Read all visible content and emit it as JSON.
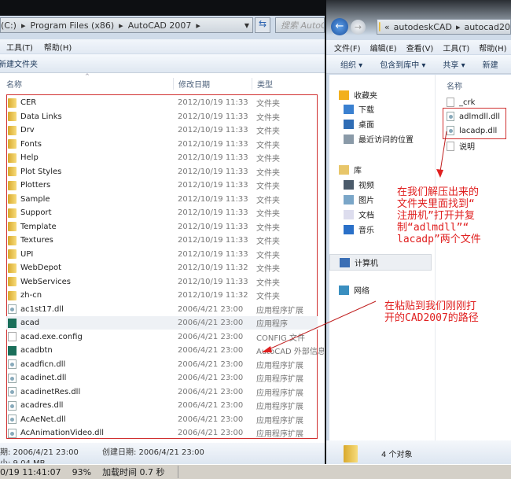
{
  "left": {
    "address": [
      "(C:)",
      "Program Files (x86)",
      "AutoCAD 2007"
    ],
    "search_placeholder": "搜索 AutoC",
    "menu": [
      "工具(T)",
      "帮助(H)"
    ],
    "toolbar": {
      "new_folder": "新建文件夹"
    },
    "columns": {
      "name": "名称",
      "date": "修改日期",
      "type": "类型"
    },
    "files": [
      {
        "name": "CER",
        "date": "2012/10/19 11:33",
        "type": "文件夹",
        "icon": "folder"
      },
      {
        "name": "Data Links",
        "date": "2012/10/19 11:33",
        "type": "文件夹",
        "icon": "folder"
      },
      {
        "name": "Drv",
        "date": "2012/10/19 11:33",
        "type": "文件夹",
        "icon": "folder"
      },
      {
        "name": "Fonts",
        "date": "2012/10/19 11:33",
        "type": "文件夹",
        "icon": "folder"
      },
      {
        "name": "Help",
        "date": "2012/10/19 11:33",
        "type": "文件夹",
        "icon": "folder"
      },
      {
        "name": "Plot Styles",
        "date": "2012/10/19 11:33",
        "type": "文件夹",
        "icon": "folder"
      },
      {
        "name": "Plotters",
        "date": "2012/10/19 11:33",
        "type": "文件夹",
        "icon": "folder"
      },
      {
        "name": "Sample",
        "date": "2012/10/19 11:33",
        "type": "文件夹",
        "icon": "folder"
      },
      {
        "name": "Support",
        "date": "2012/10/19 11:33",
        "type": "文件夹",
        "icon": "folder"
      },
      {
        "name": "Template",
        "date": "2012/10/19 11:33",
        "type": "文件夹",
        "icon": "folder"
      },
      {
        "name": "Textures",
        "date": "2012/10/19 11:33",
        "type": "文件夹",
        "icon": "folder"
      },
      {
        "name": "UPI",
        "date": "2012/10/19 11:33",
        "type": "文件夹",
        "icon": "folder"
      },
      {
        "name": "WebDepot",
        "date": "2012/10/19 11:32",
        "type": "文件夹",
        "icon": "folder"
      },
      {
        "name": "WebServices",
        "date": "2012/10/19 11:33",
        "type": "文件夹",
        "icon": "folder"
      },
      {
        "name": "zh-cn",
        "date": "2012/10/19 11:32",
        "type": "文件夹",
        "icon": "folder"
      },
      {
        "name": "ac1st17.dll",
        "date": "2006/4/21 23:00",
        "type": "应用程序扩展",
        "icon": "dll"
      },
      {
        "name": "acad",
        "date": "2006/4/21 23:00",
        "type": "应用程序",
        "icon": "exe"
      },
      {
        "name": "acad.exe.config",
        "date": "2006/4/21 23:00",
        "type": "CONFIG 文件",
        "icon": "doc"
      },
      {
        "name": "acadbtn",
        "date": "2006/4/21 23:00",
        "type": "AutoCAD 外部信息",
        "icon": "exe"
      },
      {
        "name": "acadficn.dll",
        "date": "2006/4/21 23:00",
        "type": "应用程序扩展",
        "icon": "dll"
      },
      {
        "name": "acadinet.dll",
        "date": "2006/4/21 23:00",
        "type": "应用程序扩展",
        "icon": "dll"
      },
      {
        "name": "acadinetRes.dll",
        "date": "2006/4/21 23:00",
        "type": "应用程序扩展",
        "icon": "dll"
      },
      {
        "name": "acadres.dll",
        "date": "2006/4/21 23:00",
        "type": "应用程序扩展",
        "icon": "dll"
      },
      {
        "name": "AcAeNet.dll",
        "date": "2006/4/21 23:00",
        "type": "应用程序扩展",
        "icon": "dll"
      },
      {
        "name": "AcAnimationVideo.dll",
        "date": "2006/4/21 23:00",
        "type": "应用程序扩展",
        "icon": "dll"
      }
    ],
    "details": {
      "modified": "期: 2006/4/21 23:00",
      "created": "创建日期: 2006/4/21 23:00",
      "size": "小: 9.04 MB"
    }
  },
  "right": {
    "address": [
      "autodeskCAD",
      "autocad20"
    ],
    "menu": [
      "文件(F)",
      "编辑(E)",
      "查看(V)",
      "工具(T)",
      "帮助(H)"
    ],
    "toolbar": [
      "组织 ▾",
      "包含到库中 ▾",
      "共享 ▾",
      "新建"
    ],
    "nav": [
      {
        "label": "收藏夹",
        "icon": "star"
      },
      {
        "label": "下载",
        "icon": "download"
      },
      {
        "label": "桌面",
        "icon": "desktop"
      },
      {
        "label": "最近访问的位置",
        "icon": "recent"
      },
      {
        "label": "库",
        "icon": "library"
      },
      {
        "label": "视频",
        "icon": "video"
      },
      {
        "label": "图片",
        "icon": "picture"
      },
      {
        "label": "文档",
        "icon": "document"
      },
      {
        "label": "音乐",
        "icon": "music"
      },
      {
        "label": "计算机",
        "icon": "computer"
      },
      {
        "label": "网络",
        "icon": "network"
      }
    ],
    "column_name": "名称",
    "files": [
      "_crk",
      "adlmdll.dll",
      "lacadp.dll",
      "说明"
    ],
    "count": "4 个对象"
  },
  "annotations": {
    "note1": [
      "在我们解压出来的",
      "文件夹里面找到“",
      "注册机”打开并复",
      "制“adlmdll”“",
      "lacadp”两个文件"
    ],
    "note2": [
      "在粘贴到我们刚刚打",
      "开的CAD2007的路径"
    ]
  },
  "statusbar": {
    "time": "0/19 11:41:07",
    "zoom": "93%",
    "load": "加载时间 0.7 秒"
  },
  "colors": {
    "annotation": "#e02020"
  }
}
